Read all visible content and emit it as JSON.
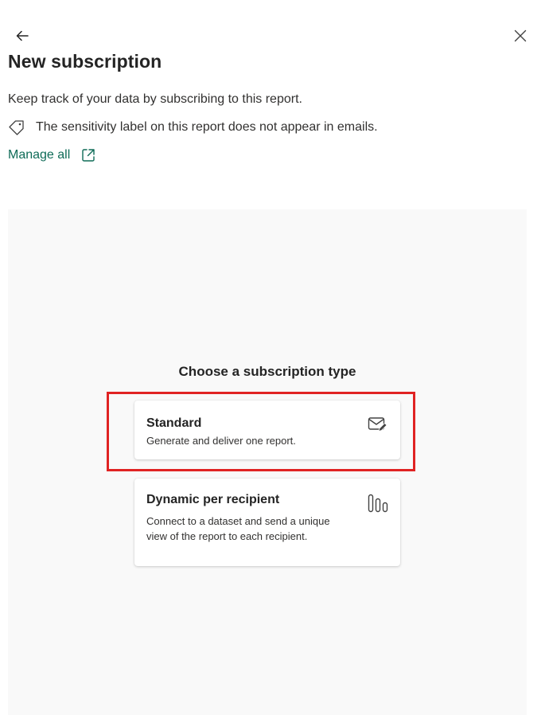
{
  "header": {
    "title": "New subscription",
    "back_icon": "arrow-left-icon",
    "close_icon": "close-icon"
  },
  "intro": {
    "description": "Keep track of your data by subscribing to this report.",
    "sensitivity_note": "The sensitivity label on this report does not appear in emails.",
    "manage_link": "Manage all"
  },
  "chooser": {
    "title": "Choose a subscription type",
    "options": [
      {
        "title": "Standard",
        "description": "Generate and deliver one report.",
        "icon": "mail-edit-icon"
      },
      {
        "title": "Dynamic per recipient",
        "description": "Connect to a dataset and send a unique view of the report to each recipient.",
        "icon": "data-bars-icon"
      }
    ]
  },
  "colors": {
    "link": "#0e6b57",
    "highlight": "#e02323",
    "panel_bg": "#f9f9f9"
  }
}
